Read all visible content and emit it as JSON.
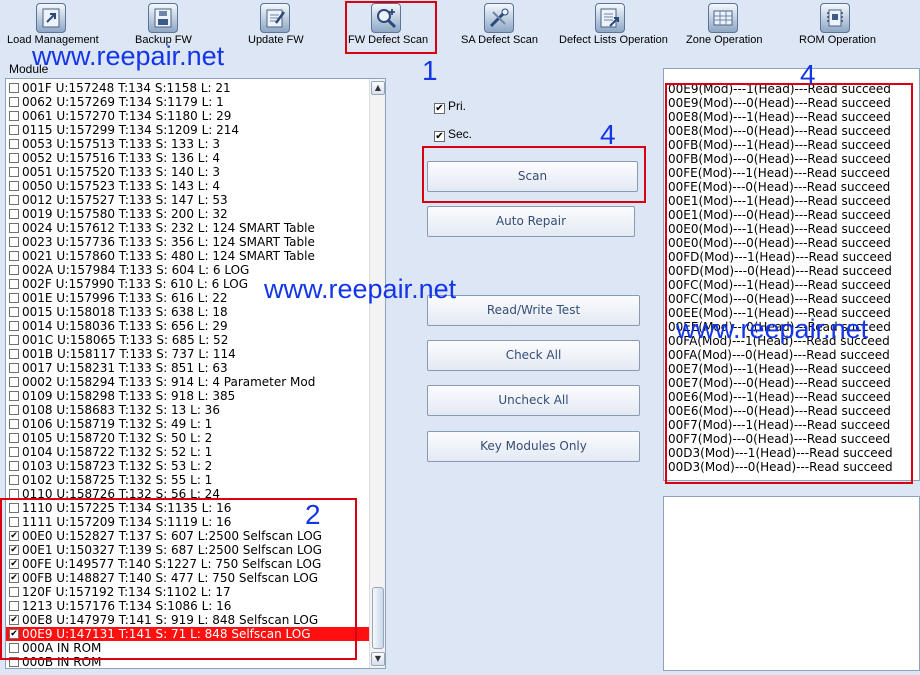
{
  "toolbar": {
    "items": [
      {
        "label": "Load Management",
        "icon": "load-management-icon"
      },
      {
        "label": "Backup FW",
        "icon": "backup-fw-icon"
      },
      {
        "label": "Update FW",
        "icon": "update-fw-icon"
      },
      {
        "label": "FW Defect Scan",
        "icon": "fw-defect-scan-icon"
      },
      {
        "label": "SA Defect Scan",
        "icon": "sa-defect-scan-icon"
      },
      {
        "label": "Defect Lists Operation",
        "icon": "defect-lists-icon"
      },
      {
        "label": "Zone Operation",
        "icon": "zone-operation-icon"
      },
      {
        "label": "ROM Operation",
        "icon": "rom-operation-icon"
      }
    ]
  },
  "module_panel": {
    "label": "Module",
    "rows": [
      {
        "text": "001F U:157248 T:134 S:1158 L:  21",
        "checked": false
      },
      {
        "text": "0062 U:157269 T:134 S:1179 L:   1",
        "checked": false
      },
      {
        "text": "0061 U:157270 T:134 S:1180 L:  29",
        "checked": false
      },
      {
        "text": "0115 U:157299 T:134 S:1209 L: 214",
        "checked": false
      },
      {
        "text": "0053 U:157513 T:133 S: 133 L:   3",
        "checked": false
      },
      {
        "text": "0052 U:157516 T:133 S: 136 L:   4",
        "checked": false
      },
      {
        "text": "0051 U:157520 T:133 S: 140 L:   3",
        "checked": false
      },
      {
        "text": "0050 U:157523 T:133 S: 143 L:   4",
        "checked": false
      },
      {
        "text": "0012 U:157527 T:133 S: 147 L:  53",
        "checked": false
      },
      {
        "text": "0019 U:157580 T:133 S: 200 L:  32",
        "checked": false
      },
      {
        "text": "0024 U:157612 T:133 S: 232 L: 124  SMART Table",
        "checked": false
      },
      {
        "text": "0023 U:157736 T:133 S: 356 L: 124  SMART Table",
        "checked": false
      },
      {
        "text": "0021 U:157860 T:133 S: 480 L: 124  SMART Table",
        "checked": false
      },
      {
        "text": "002A U:157984 T:133 S: 604 L:   6  LOG",
        "checked": false
      },
      {
        "text": "002F U:157990 T:133 S: 610 L:   6  LOG",
        "checked": false
      },
      {
        "text": "001E U:157996 T:133 S: 616 L:  22",
        "checked": false
      },
      {
        "text": "0015 U:158018 T:133 S: 638 L:  18",
        "checked": false
      },
      {
        "text": "0014 U:158036 T:133 S: 656 L:  29",
        "checked": false
      },
      {
        "text": "001C U:158065 T:133 S: 685 L:  52",
        "checked": false
      },
      {
        "text": "001B U:158117 T:133 S: 737 L: 114",
        "checked": false
      },
      {
        "text": "0017 U:158231 T:133 S: 851 L:  63",
        "checked": false
      },
      {
        "text": "0002 U:158294 T:133 S: 914 L:   4  Parameter Mod",
        "checked": false
      },
      {
        "text": "0109 U:158298 T:133 S: 918 L: 385",
        "checked": false
      },
      {
        "text": "0108 U:158683 T:132 S:  13 L:  36",
        "checked": false
      },
      {
        "text": "0106 U:158719 T:132 S:  49 L:   1",
        "checked": false
      },
      {
        "text": "0105 U:158720 T:132 S:  50 L:   2",
        "checked": false
      },
      {
        "text": "0104 U:158722 T:132 S:  52 L:   1",
        "checked": false
      },
      {
        "text": "0103 U:158723 T:132 S:  53 L:   2",
        "checked": false
      },
      {
        "text": "0102 U:158725 T:132 S:  55 L:   1",
        "checked": false
      },
      {
        "text": "0110 U:158726 T:132 S:  56 L:  24",
        "checked": false
      },
      {
        "text": "1110 U:157225 T:134 S:1135 L:  16",
        "checked": false
      },
      {
        "text": "1111 U:157209 T:134 S:1119 L:  16",
        "checked": false
      },
      {
        "text": "00E0 U:152827 T:137 S: 607 L:2500  Selfscan LOG",
        "checked": true
      },
      {
        "text": "00E1 U:150327 T:139 S: 687 L:2500  Selfscan LOG",
        "checked": true
      },
      {
        "text": "00FE U:149577 T:140 S:1227 L: 750  Selfscan LOG",
        "checked": true
      },
      {
        "text": "00FB U:148827 T:140 S: 477 L: 750  Selfscan LOG",
        "checked": true
      },
      {
        "text": "120F U:157192 T:134 S:1102 L:  17",
        "checked": false
      },
      {
        "text": "1213 U:157176 T:134 S:1086 L:  16",
        "checked": false
      },
      {
        "text": "00E8 U:147979 T:141 S: 919 L: 848  Selfscan LOG",
        "checked": true
      },
      {
        "text": "00E9 U:147131 T:141 S:  71 L: 848  Selfscan LOG",
        "checked": true,
        "selected": true
      },
      {
        "text": "000A IN ROM",
        "checked": false
      },
      {
        "text": "000B IN ROM",
        "checked": false
      }
    ]
  },
  "controls": {
    "pri_label": "Pri.",
    "pri_checked": true,
    "sec_label": "Sec.",
    "sec_checked": true,
    "scan_label": "Scan",
    "auto_repair_label": "Auto Repair",
    "rw_test_label": "Read/Write Test",
    "check_all_label": "Check All",
    "uncheck_all_label": "Uncheck All",
    "key_modules_label": "Key Modules Only"
  },
  "log": {
    "lines": [
      "00E9(Mod)---1(Head)---Read succeed",
      "00E9(Mod)---0(Head)---Read succeed",
      "00E8(Mod)---1(Head)---Read succeed",
      "00E8(Mod)---0(Head)---Read succeed",
      "00FB(Mod)---1(Head)---Read succeed",
      "00FB(Mod)---0(Head)---Read succeed",
      "00FE(Mod)---1(Head)---Read succeed",
      "00FE(Mod)---0(Head)---Read succeed",
      "00E1(Mod)---1(Head)---Read succeed",
      "00E1(Mod)---0(Head)---Read succeed",
      "00E0(Mod)---1(Head)---Read succeed",
      "00E0(Mod)---0(Head)---Read succeed",
      "00FD(Mod)---1(Head)---Read succeed",
      "00FD(Mod)---0(Head)---Read succeed",
      "00FC(Mod)---1(Head)---Read succeed",
      "00FC(Mod)---0(Head)---Read succeed",
      "00EE(Mod)---1(Head)---Read succeed",
      "00EE(Mod)---0(Head)---Read succeed",
      "00FA(Mod)---1(Head)---Read succeed",
      "00FA(Mod)---0(Head)---Read succeed",
      "00E7(Mod)---1(Head)---Read succeed",
      "00E7(Mod)---0(Head)---Read succeed",
      "00E6(Mod)---1(Head)---Read succeed",
      "00E6(Mod)---0(Head)---Read succeed",
      "00F7(Mod)---1(Head)---Read succeed",
      "00F7(Mod)---0(Head)---Read succeed",
      "00D3(Mod)---1(Head)---Read succeed",
      "00D3(Mod)---0(Head)---Read succeed"
    ]
  },
  "annotations": {
    "marker_1": "1",
    "marker_2": "2",
    "marker_4a": "4",
    "marker_4b": "4",
    "watermark_1": "www.reepair.net",
    "watermark_2": "www.reepair.net",
    "watermark_3": "www.reepair.net",
    "highlight_color": "#d9000f",
    "annotation_color": "#1436e6"
  },
  "colors": {
    "selected_row": "#ff0f0f",
    "background": "#dce6f4"
  }
}
